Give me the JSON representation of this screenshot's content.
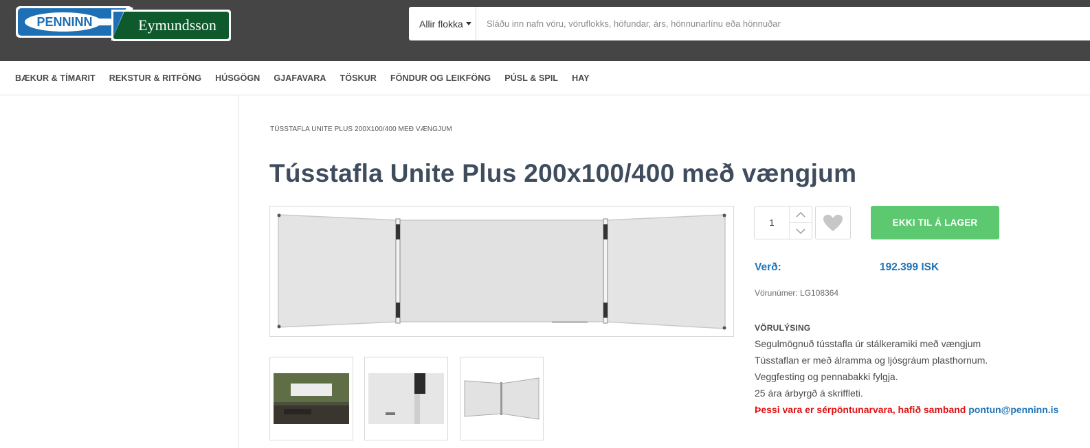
{
  "header": {
    "logo_left": "PENNINN",
    "logo_right": "Eymundsson",
    "search": {
      "category": "Allir flokkar",
      "placeholder": "Sláðu inn nafn vöru, vöruflokks, höfundar, árs, hönnunarlínu eða hönnuðar"
    }
  },
  "nav": {
    "items": [
      "BÆKUR & TÍMARIT",
      "REKSTUR & RITFÖNG",
      "HÚSGÖGN",
      "GJAFAVARA",
      "TÖSKUR",
      "FÖNDUR OG LEIKFÖNG",
      "PÚSL & SPIL",
      "HAY"
    ]
  },
  "product": {
    "breadcrumb": "TÚSSTAFLA UNITE PLUS 200X100/400 MEÐ VÆNGJUM",
    "title": "Tússtafla Unite Plus 200x100/400 með vængjum",
    "quantity": "1",
    "cart_button": "EKKI TIL Á LAGER",
    "price_label": "Verð:",
    "price_value": "192.399 ISK",
    "sku": "Vörunúmer: LG108364",
    "description_heading": "VÖRULÝSING",
    "description_lines": [
      "Segulmögnuð tússtafla úr stálkeramiki með vængjum",
      "Tússtaflan er með álramma og ljósgráum plasthornum.",
      "Veggfesting og pennabakki fylgja.",
      "25 ára árbyrgð á skriffleti."
    ],
    "notice_text": "Þessi vara er sérpöntunarvara, hafið samband",
    "notice_email": "pontun@penninn.is"
  },
  "colors": {
    "header_bg": "#454545",
    "accent_blue": "#1f74b8",
    "button_green": "#5cc86f",
    "notice_red": "#e01010"
  },
  "icons": {
    "qty_up": "chevron-up-icon",
    "qty_down": "chevron-down-icon",
    "favorite": "heart-icon",
    "search_dropdown": "caret-down-icon"
  }
}
